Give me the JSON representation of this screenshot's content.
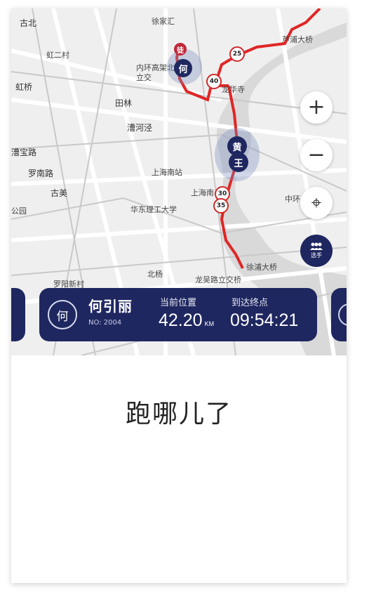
{
  "map": {
    "labels": [
      "古北",
      "虹二村",
      "虹桥",
      "田林",
      "漕河泾",
      "漕宝路",
      "罗南路",
      "古美",
      "公园",
      "上海南站",
      "上海南",
      "华东理工大学",
      "中环",
      "北杨",
      "罗阳新村",
      "龙吴路立交桥",
      "徐浦大桥",
      "芦浦大桥",
      "徐家汇",
      "内环高架北路立交",
      "龙华寺"
    ],
    "road_numbers": [
      "25",
      "40",
      "30",
      "35"
    ],
    "markers": [
      {
        "name": "徒",
        "color": "#c0283a"
      },
      {
        "name": "何",
        "color": "#1f2760"
      },
      {
        "name": "黄",
        "color": "#1f2760"
      },
      {
        "name": "王",
        "color": "#1f2760"
      }
    ],
    "controls": {
      "zoom_in": "+",
      "zoom_out": "−",
      "locate": "⌖",
      "players_label": "选手"
    }
  },
  "panel": {
    "avatar_char": "何",
    "name": "何引丽",
    "number": "NO: 2004",
    "distance_label": "当前位置",
    "distance_value": "42.20",
    "distance_unit": "KM",
    "arrival_label": "到达终点",
    "arrival_value": "09:54:21"
  },
  "caption": "跑哪儿了",
  "colors": {
    "route": "#e02626",
    "panel": "#1f2760"
  }
}
